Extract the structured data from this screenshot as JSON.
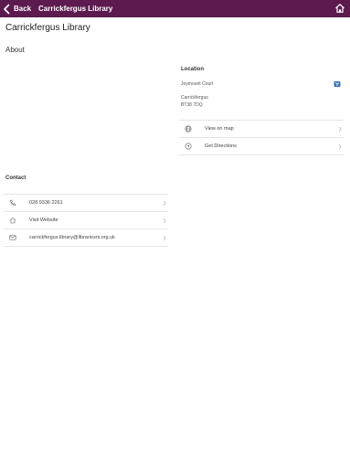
{
  "navbar": {
    "back_label": "Back",
    "title": "Carrickfergus Library",
    "background": "#5c1a4f",
    "back_icon": "chevron-left-icon",
    "home_icon": "home-icon"
  },
  "page": {
    "title": "Carrickfergus Library",
    "about_heading": "About"
  },
  "location": {
    "heading": "Location",
    "address_line1": "Joymount Court",
    "town": "Carrickfergus",
    "postcode": "BT38 7DQ",
    "map_icon": "map-icon",
    "actions": [
      {
        "label": "View on map",
        "icon": "globe-icon"
      },
      {
        "label": "Get Directions",
        "icon": "directions-icon"
      }
    ]
  },
  "contact": {
    "heading": "Contact",
    "items": [
      {
        "label": "028 9336 2261",
        "icon": "phone-icon"
      },
      {
        "label": "Visit Website",
        "icon": "home-icon"
      },
      {
        "label": "carrickfergus.library@librariesni.org.uk",
        "icon": "mail-icon"
      }
    ]
  }
}
